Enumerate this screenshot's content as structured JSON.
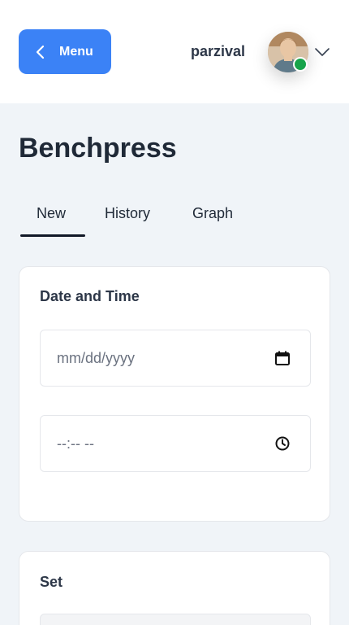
{
  "header": {
    "menu_label": "Menu",
    "username": "parzival",
    "status_color": "#16a34a",
    "accent_color": "#3b82f6"
  },
  "page": {
    "title": "Benchpress"
  },
  "tabs": [
    {
      "label": "New",
      "active": true
    },
    {
      "label": "History",
      "active": false
    },
    {
      "label": "Graph",
      "active": false
    }
  ],
  "date_time_card": {
    "title": "Date and Time",
    "date_placeholder": "mm/dd/yyyy",
    "date_icon": "calendar-icon",
    "time_placeholder": "--:-- --",
    "time_icon": "clock-icon"
  },
  "set_card": {
    "title": "Set"
  }
}
